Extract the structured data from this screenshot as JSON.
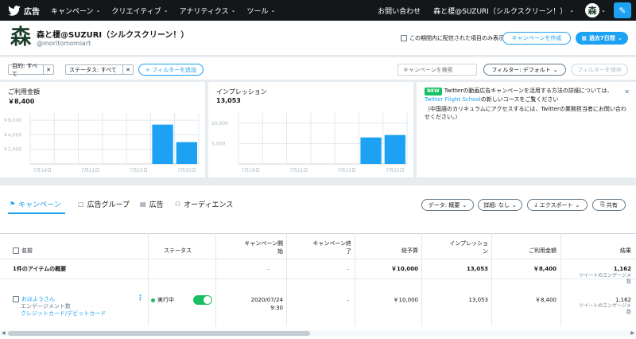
{
  "nav": {
    "logo": "広告",
    "items": [
      "キャンペーン",
      "クリエイティブ",
      "アナリティクス",
      "ツール"
    ],
    "contact": "お問い合わせ",
    "account": "森と榎@SUZURI（シルクスクリーン！）"
  },
  "account": {
    "avatar_char": "森",
    "name": "森と榎@SUZURI（シルクスクリーン！）",
    "handle": "@moritomomiart",
    "only_delivered_label": "この期間内に配信された項目のみ表示",
    "create_campaign": "キャンペーンを作成",
    "date_range": "過去7日間"
  },
  "filters": {
    "chips": [
      {
        "label": "目的: すべて"
      },
      {
        "label": "ステータス: すべて"
      }
    ],
    "add_filter": "+ フィルターを追加",
    "search_placeholder": "キャンペーンを検索",
    "default_filter": "フィルター: デフォルト",
    "save_filter": "フィルターを保存"
  },
  "metrics": {
    "spend_label": "ご利用金額",
    "spend_value": "￥8,400",
    "impr_label": "インプレッション",
    "impr_value": "13,053"
  },
  "news": {
    "badge": "NEW",
    "text1": "Twitterの動画広告キャンペーンを活用する方法の詳細については、",
    "link": "Twitter Flight School",
    "text2": "の新しいコースをご覧ください",
    "text3": "（中国語のカリキュラムにアクセスするには、Twitterの業務担当者にお問い合わせください。）"
  },
  "chart_data": [
    {
      "type": "bar",
      "categories": [
        "7月19日",
        "7月20日",
        "7月21日",
        "7月22日",
        "7月23日",
        "7月24日",
        "7月25日"
      ],
      "values": [
        0,
        0,
        0,
        0,
        0,
        5400,
        3000
      ],
      "yticks": [
        "￥6,000",
        "￥4,000",
        "￥2,000"
      ],
      "xticks": [
        "7月19日",
        "7月21日",
        "7月23日",
        "7月25日"
      ],
      "ylim": [
        0,
        7000
      ],
      "color": "#1da1f2"
    },
    {
      "type": "bar",
      "categories": [
        "7月19日",
        "7月20日",
        "7月21日",
        "7月22日",
        "7月23日",
        "7月24日",
        "7月25日"
      ],
      "values": [
        0,
        0,
        0,
        0,
        0,
        6500,
        7100
      ],
      "yticks": [
        "10,000",
        "5,000"
      ],
      "xticks": [
        "7月19日",
        "7月21日",
        "7月23日",
        "7月25日"
      ],
      "ylim": [
        0,
        12500
      ],
      "color": "#1da1f2"
    }
  ],
  "tabs": [
    "キャンペーン",
    "広告グループ",
    "広告",
    "オーディエンス"
  ],
  "table_buttons": {
    "data": "データ: 概要",
    "detail": "詳細: なし",
    "export": "エクスポート",
    "share": "共有"
  },
  "table": {
    "headers": {
      "name": "名前",
      "status": "ステータス",
      "start": [
        "キャンペーン開",
        "始"
      ],
      "end": [
        "キャンペーン終",
        "了"
      ],
      "budget": "総予算",
      "impressions": [
        "インプレッショ",
        "ン"
      ],
      "spend": "ご利用金額",
      "results": "結果"
    },
    "summary": {
      "label": "1件のアイテムの概要",
      "start": "–",
      "end": "–",
      "budget": "￥10,000",
      "impressions": "13,053",
      "spend": "￥8,400",
      "results": "1,162",
      "results_sub": [
        "ツイートのエンゲージメ",
        "数"
      ]
    },
    "row": {
      "name": "おはようさん",
      "name_sub1": "エンゲージメント数",
      "name_sub2": "クレジットカード/デビットカード",
      "status": "実行中",
      "start": [
        "2020/07/24",
        "9:30"
      ],
      "end": "–",
      "budget": "￥10,000",
      "impressions": "13,053",
      "spend": "￥8,400",
      "results": "1,162",
      "results_sub": [
        "ツイートのエンゲージメ",
        "数"
      ]
    }
  }
}
